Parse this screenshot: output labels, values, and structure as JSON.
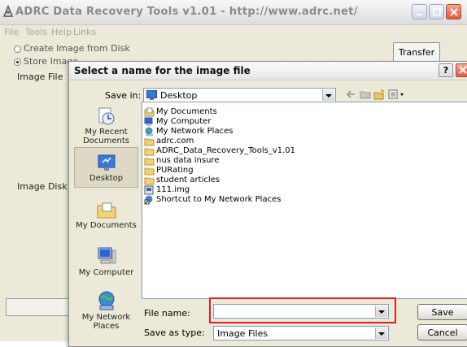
{
  "main_window": {
    "title": "ADRC Data Recovery Tools v1.01 - http://www.adrc.net/",
    "menu": [
      "File",
      "Tools",
      "Help",
      "Links"
    ],
    "options": [
      {
        "label": "Create Image from Disk",
        "selected": false
      },
      {
        "label": "Store Image",
        "selected": true
      }
    ],
    "image_file_label": "Image File",
    "image_disk_label": "Image Disk",
    "transfer_button": "Transfer"
  },
  "dialog": {
    "title": "Select a name for the image file",
    "help_label": "?",
    "save_in_label": "Save in:",
    "save_in_value": "Desktop",
    "places": [
      "My Recent Documents",
      "Desktop",
      "My Documents",
      "My Computer",
      "My Network Places"
    ],
    "files": [
      {
        "name": "My Documents",
        "icon": "my-documents-folder-icon"
      },
      {
        "name": "My Computer",
        "icon": "my-computer-icon"
      },
      {
        "name": "My Network Places",
        "icon": "network-places-icon"
      },
      {
        "name": "adrc.com",
        "icon": "folder-icon"
      },
      {
        "name": "ADRC_Data_Recovery_Tools_v1.01",
        "icon": "folder-icon"
      },
      {
        "name": "nus data insure",
        "icon": "folder-icon"
      },
      {
        "name": "PURating",
        "icon": "folder-icon"
      },
      {
        "name": "student articles",
        "icon": "folder-icon"
      },
      {
        "name": "111.img",
        "icon": "image-file-icon"
      },
      {
        "name": "Shortcut to My Network Places",
        "icon": "shortcut-icon"
      }
    ],
    "file_name_label": "File name:",
    "file_name_value": "",
    "save_as_type_label": "Save as type:",
    "save_as_type_value": "Image Files",
    "save_button": "Save",
    "cancel_button": "Cancel"
  }
}
